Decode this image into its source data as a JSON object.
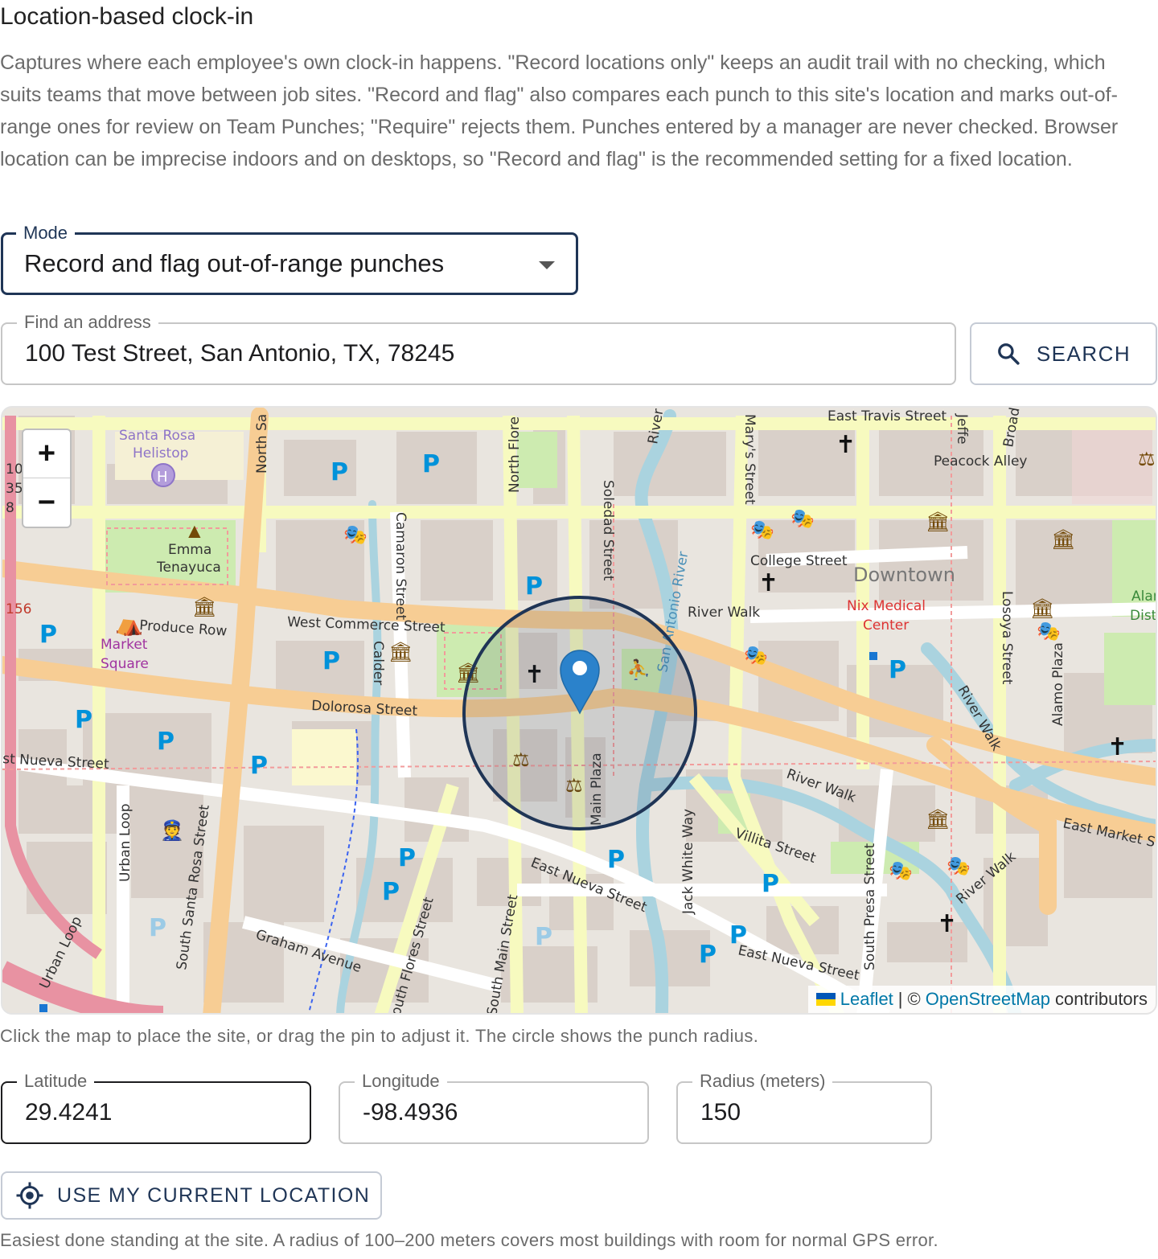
{
  "section": {
    "title": "Location-based clock-in",
    "description": "Captures where each employee's own clock-in happens. \"Record locations only\" keeps an audit trail with no checking, which suits teams that move between job sites. \"Record and flag\" also compares each punch to this site's location and marks out-of-range ones for review on Team Punches; \"Require\" rejects them. Punches entered by a manager are never checked. Browser location can be imprecise indoors and on desktops, so \"Record and flag\" is the recommended setting for a fixed location."
  },
  "mode": {
    "label": "Mode",
    "selected": "Record and flag out-of-range punches"
  },
  "address": {
    "label": "Find an address",
    "value": "100 Test Street, San Antonio, TX, 78245"
  },
  "search_button": {
    "label": "SEARCH",
    "icon": "search-icon"
  },
  "map": {
    "zoom_in": "+",
    "zoom_out": "−",
    "attribution": {
      "leaflet": "Leaflet",
      "separator": "|",
      "copyright": "©",
      "osm": "OpenStreetMap",
      "suffix": "contributors"
    },
    "labels": {
      "east_travis": "East Travis Street",
      "peacock": "Peacock Alley",
      "santa_rosa_helistop": [
        "Santa Rosa",
        "Helistop"
      ],
      "emma_tenayuca": [
        "Emma",
        "Tenayuca"
      ],
      "produce_row": "Produce Row",
      "market_square": [
        "Market",
        "Square"
      ],
      "west_commerce": "West Commerce Street",
      "dolorosa": "Dolorosa Street",
      "nueva_west": "st Nueva Street",
      "college": "College Street",
      "downtown": "Downtown",
      "nix": [
        "Nix Medical",
        "Center"
      ],
      "river_walk": "River Walk",
      "alamo_district": [
        "Alamo",
        "District"
      ],
      "east_market": "East Market S",
      "east_nueva_1": "East Nueva Street",
      "east_nueva_2": "East Nueva Street",
      "graham": "Graham Avenue",
      "villita": "Villita Street",
      "north_sa": "North Sa",
      "north_flores": "North Flore",
      "soledad": "Soledad Street",
      "marys": "Mary's Street",
      "camaron": "Camaron Street",
      "calder": "Calder",
      "san_antonio_river": "San Antonio River",
      "losoya": "Losoya Street",
      "alamo_plaza": "Alamo Plaza",
      "main_plaza": "Main Plaza",
      "jack_white": "Jack White Way",
      "south_presa": "South Presa Street",
      "south_santa_rosa": "South Santa Rosa Street",
      "south_flores": "outh Flores Street",
      "south_main": "South Main Street",
      "urban_loop_1": "Urban Loop",
      "urban_loop_2": "Urban Loop",
      "river_walk_2": "River Walk",
      "river_walk_3": "River Walk",
      "river_walk_4": "River Walk",
      "jeffe": "Jeffe",
      "broad": "Broad",
      "river_top": "River",
      "hwy_10": [
        "10",
        "35",
        "8"
      ],
      "hwy_156": "156"
    },
    "site": {
      "latitude": 29.4241,
      "longitude": -98.4936,
      "radius_m": 150
    }
  },
  "map_hint": "Click the map to place the site, or drag the pin to adjust it. The circle shows the punch radius.",
  "latitude": {
    "label": "Latitude",
    "value": "29.4241"
  },
  "longitude": {
    "label": "Longitude",
    "value": "-98.4936"
  },
  "radius": {
    "label": "Radius (meters)",
    "value": "150"
  },
  "location_button": {
    "label": "USE MY CURRENT LOCATION",
    "icon": "crosshair-icon"
  },
  "footer_hint": "Easiest done standing at the site. A radius of 100–200 meters covers most buildings with room for normal GPS error.",
  "colors": {
    "accent": "#1f3556",
    "link": "#0078a8",
    "muted_text": "#6b6b6b",
    "major_road": "#f7cd94",
    "minor_road": "#f7fabf",
    "park": "#cdebb0",
    "water": "#aad3df",
    "building": "#d9d0c9",
    "pin": "#2b82cb"
  }
}
